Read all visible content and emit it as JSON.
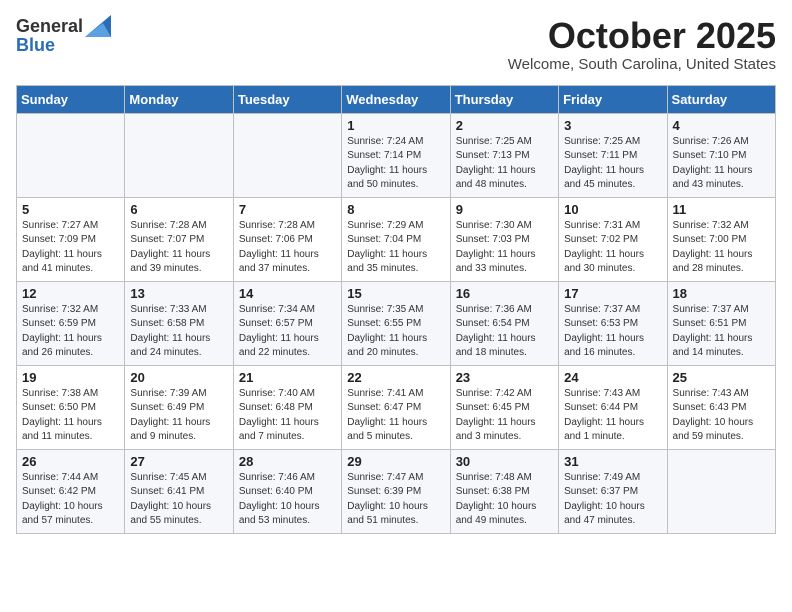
{
  "header": {
    "logo_general": "General",
    "logo_blue": "Blue",
    "month": "October 2025",
    "location": "Welcome, South Carolina, United States"
  },
  "days_of_week": [
    "Sunday",
    "Monday",
    "Tuesday",
    "Wednesday",
    "Thursday",
    "Friday",
    "Saturday"
  ],
  "weeks": [
    [
      {
        "day": "",
        "info": ""
      },
      {
        "day": "",
        "info": ""
      },
      {
        "day": "",
        "info": ""
      },
      {
        "day": "1",
        "info": "Sunrise: 7:24 AM\nSunset: 7:14 PM\nDaylight: 11 hours\nand 50 minutes."
      },
      {
        "day": "2",
        "info": "Sunrise: 7:25 AM\nSunset: 7:13 PM\nDaylight: 11 hours\nand 48 minutes."
      },
      {
        "day": "3",
        "info": "Sunrise: 7:25 AM\nSunset: 7:11 PM\nDaylight: 11 hours\nand 45 minutes."
      },
      {
        "day": "4",
        "info": "Sunrise: 7:26 AM\nSunset: 7:10 PM\nDaylight: 11 hours\nand 43 minutes."
      }
    ],
    [
      {
        "day": "5",
        "info": "Sunrise: 7:27 AM\nSunset: 7:09 PM\nDaylight: 11 hours\nand 41 minutes."
      },
      {
        "day": "6",
        "info": "Sunrise: 7:28 AM\nSunset: 7:07 PM\nDaylight: 11 hours\nand 39 minutes."
      },
      {
        "day": "7",
        "info": "Sunrise: 7:28 AM\nSunset: 7:06 PM\nDaylight: 11 hours\nand 37 minutes."
      },
      {
        "day": "8",
        "info": "Sunrise: 7:29 AM\nSunset: 7:04 PM\nDaylight: 11 hours\nand 35 minutes."
      },
      {
        "day": "9",
        "info": "Sunrise: 7:30 AM\nSunset: 7:03 PM\nDaylight: 11 hours\nand 33 minutes."
      },
      {
        "day": "10",
        "info": "Sunrise: 7:31 AM\nSunset: 7:02 PM\nDaylight: 11 hours\nand 30 minutes."
      },
      {
        "day": "11",
        "info": "Sunrise: 7:32 AM\nSunset: 7:00 PM\nDaylight: 11 hours\nand 28 minutes."
      }
    ],
    [
      {
        "day": "12",
        "info": "Sunrise: 7:32 AM\nSunset: 6:59 PM\nDaylight: 11 hours\nand 26 minutes."
      },
      {
        "day": "13",
        "info": "Sunrise: 7:33 AM\nSunset: 6:58 PM\nDaylight: 11 hours\nand 24 minutes."
      },
      {
        "day": "14",
        "info": "Sunrise: 7:34 AM\nSunset: 6:57 PM\nDaylight: 11 hours\nand 22 minutes."
      },
      {
        "day": "15",
        "info": "Sunrise: 7:35 AM\nSunset: 6:55 PM\nDaylight: 11 hours\nand 20 minutes."
      },
      {
        "day": "16",
        "info": "Sunrise: 7:36 AM\nSunset: 6:54 PM\nDaylight: 11 hours\nand 18 minutes."
      },
      {
        "day": "17",
        "info": "Sunrise: 7:37 AM\nSunset: 6:53 PM\nDaylight: 11 hours\nand 16 minutes."
      },
      {
        "day": "18",
        "info": "Sunrise: 7:37 AM\nSunset: 6:51 PM\nDaylight: 11 hours\nand 14 minutes."
      }
    ],
    [
      {
        "day": "19",
        "info": "Sunrise: 7:38 AM\nSunset: 6:50 PM\nDaylight: 11 hours\nand 11 minutes."
      },
      {
        "day": "20",
        "info": "Sunrise: 7:39 AM\nSunset: 6:49 PM\nDaylight: 11 hours\nand 9 minutes."
      },
      {
        "day": "21",
        "info": "Sunrise: 7:40 AM\nSunset: 6:48 PM\nDaylight: 11 hours\nand 7 minutes."
      },
      {
        "day": "22",
        "info": "Sunrise: 7:41 AM\nSunset: 6:47 PM\nDaylight: 11 hours\nand 5 minutes."
      },
      {
        "day": "23",
        "info": "Sunrise: 7:42 AM\nSunset: 6:45 PM\nDaylight: 11 hours\nand 3 minutes."
      },
      {
        "day": "24",
        "info": "Sunrise: 7:43 AM\nSunset: 6:44 PM\nDaylight: 11 hours\nand 1 minute."
      },
      {
        "day": "25",
        "info": "Sunrise: 7:43 AM\nSunset: 6:43 PM\nDaylight: 10 hours\nand 59 minutes."
      }
    ],
    [
      {
        "day": "26",
        "info": "Sunrise: 7:44 AM\nSunset: 6:42 PM\nDaylight: 10 hours\nand 57 minutes."
      },
      {
        "day": "27",
        "info": "Sunrise: 7:45 AM\nSunset: 6:41 PM\nDaylight: 10 hours\nand 55 minutes."
      },
      {
        "day": "28",
        "info": "Sunrise: 7:46 AM\nSunset: 6:40 PM\nDaylight: 10 hours\nand 53 minutes."
      },
      {
        "day": "29",
        "info": "Sunrise: 7:47 AM\nSunset: 6:39 PM\nDaylight: 10 hours\nand 51 minutes."
      },
      {
        "day": "30",
        "info": "Sunrise: 7:48 AM\nSunset: 6:38 PM\nDaylight: 10 hours\nand 49 minutes."
      },
      {
        "day": "31",
        "info": "Sunrise: 7:49 AM\nSunset: 6:37 PM\nDaylight: 10 hours\nand 47 minutes."
      },
      {
        "day": "",
        "info": ""
      }
    ]
  ]
}
